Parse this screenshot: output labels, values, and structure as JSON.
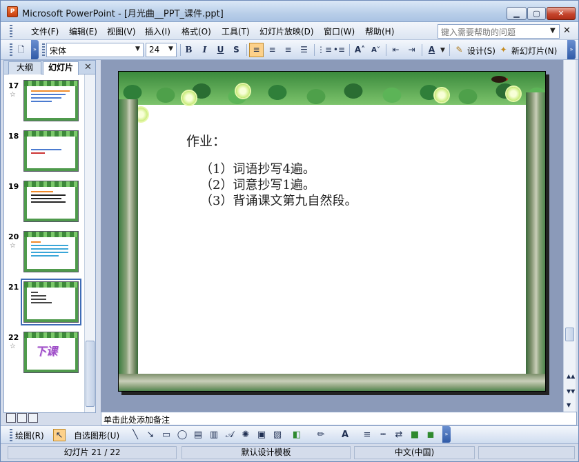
{
  "window": {
    "title": "Microsoft PowerPoint - [月光曲__PPT_课件.ppt]",
    "icon_label": "P"
  },
  "menu": {
    "items": [
      "文件(F)",
      "编辑(E)",
      "视图(V)",
      "插入(I)",
      "格式(O)",
      "工具(T)",
      "幻灯片放映(D)",
      "窗口(W)",
      "帮助(H)"
    ],
    "help_placeholder": "键入需要帮助的问题"
  },
  "toolbar": {
    "font_name": "宋体",
    "font_size": "24",
    "bold": "B",
    "italic": "I",
    "underline": "U",
    "shadow": "S",
    "design_label": "设计(S)",
    "new_slide_label": "新幻灯片(N)"
  },
  "panel": {
    "tab_outline": "大纲",
    "tab_slides": "幻灯片",
    "slides": [
      {
        "number": "17",
        "has_animation": true
      },
      {
        "number": "18",
        "has_animation": false
      },
      {
        "number": "19",
        "has_animation": false
      },
      {
        "number": "20",
        "has_animation": true
      },
      {
        "number": "21",
        "has_animation": false,
        "selected": true
      },
      {
        "number": "22",
        "has_animation": true,
        "label": "下课"
      }
    ]
  },
  "slide": {
    "title": "作业：",
    "items": [
      "（1）词语抄写4遍。",
      "（2）词意抄写1遍。",
      "（3）背诵课文第九自然段。"
    ]
  },
  "notes": {
    "placeholder": "单击此处添加备注"
  },
  "drawbar": {
    "draw_label": "绘图(R)",
    "autoshape_label": "自选图形(U)"
  },
  "status": {
    "slide_position": "幻灯片 21 / 22",
    "template": "默认设计模板",
    "language": "中文(中国)"
  },
  "colors": {
    "accent": "#3d6bb6",
    "frame_green": "#3b8a3d"
  }
}
